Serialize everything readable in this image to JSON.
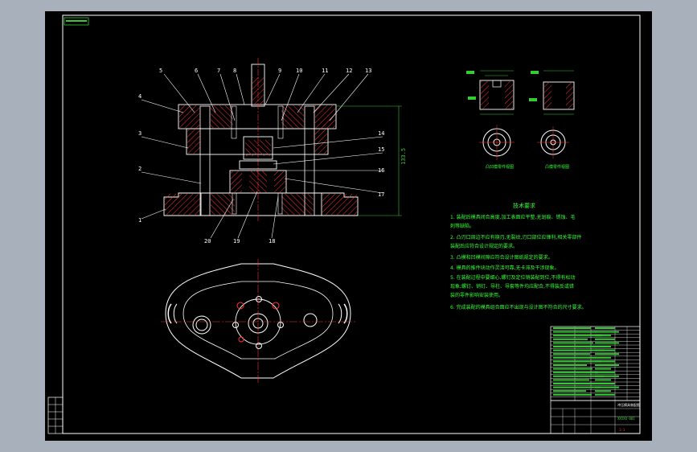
{
  "colors": {
    "background": "#000000",
    "frame": "#ffffff",
    "outline": "#ffffff",
    "hatch": "#ff3333",
    "centerline": "#ff3333",
    "dimension": "#33cc33",
    "note_text": "#33ff33",
    "part_label": "#ffffff",
    "window_bg": "#a8b0bb"
  },
  "part_numbers_top": [
    "5",
    "6",
    "7",
    "8",
    "9",
    "10",
    "11",
    "12",
    "13"
  ],
  "part_numbers_left": [
    "4",
    "3",
    "2",
    "1"
  ],
  "part_numbers_right": [
    "14",
    "15",
    "16",
    "17"
  ],
  "part_numbers_bottom": [
    "20",
    "19",
    "18"
  ],
  "overall_height_dim": "133.5",
  "detail_views": {
    "left_caption": "凸凹模零件视图",
    "right_caption": "凸模零件视图"
  },
  "notes": {
    "title": "技术要求",
    "items": [
      "1. 装配后模具闭合高度,加工表面应平整,无划痕、锈蚀、毛",
      "   刺等缺陷。",
      "2. 凸刃口周边不应有崩刃,无裂纹,刃口部位应锋利,相关零部件",
      "   装配后应符合设计规定的要求。",
      "3. 凸模和凹模间隙应符合设计图纸规定的要求。",
      "4. 模具的推件块动作灵活可靠,无卡滞及干涉现象。",
      "5. 在装配过程中要细心,螺钉及定位销装配到位,不得有松动",
      "   现象;螺钉、销钉、导柱、导套等件均应配合,不得装反或错",
      "   装的零件影响安装使用。",
      "6. 完成装配的模具组合面应不出现与设计图不符合的尺寸要求。"
    ]
  },
  "title_block": {
    "drawing_name": "冲压模具装配图",
    "drawing_no": "XXXXX-001",
    "scale_note": "1:1"
  }
}
